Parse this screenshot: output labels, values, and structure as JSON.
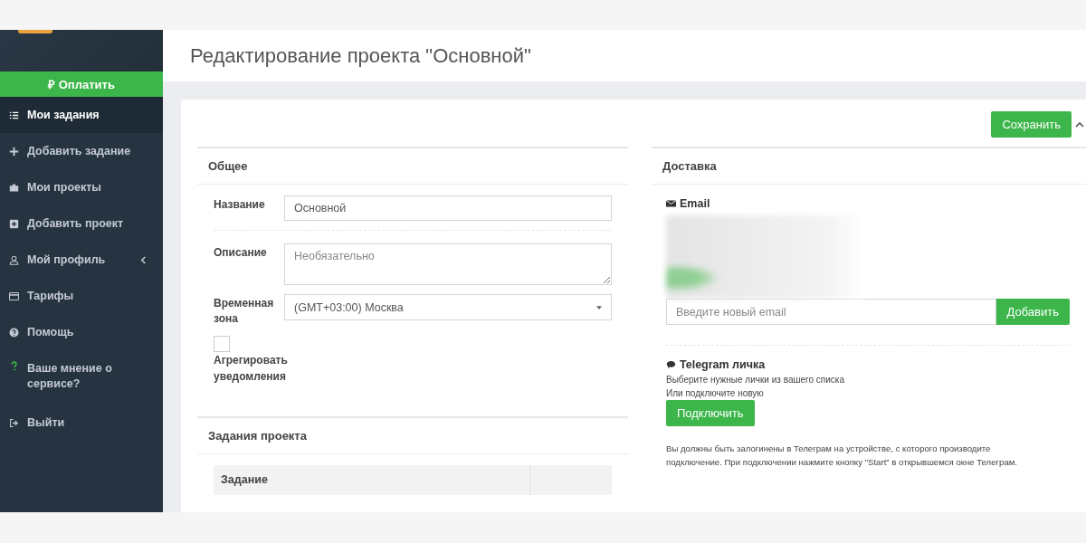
{
  "sidebar": {
    "pay_button": {
      "icon": "₽",
      "label": "Оплатить"
    },
    "items": [
      {
        "kind": "list",
        "label": "Мои задания",
        "selected": true,
        "submenu": false
      },
      {
        "kind": "plus",
        "label": "Добавить задание",
        "selected": false,
        "submenu": false
      },
      {
        "kind": "briefcase",
        "label": "Мои проекты",
        "selected": false,
        "submenu": false
      },
      {
        "kind": "plus-square",
        "label": "Добавить проект",
        "selected": false,
        "submenu": false
      },
      {
        "kind": "user",
        "label": "Мой профиль",
        "selected": false,
        "submenu": true
      },
      {
        "kind": "card",
        "label": "Тарифы",
        "selected": false,
        "submenu": false
      },
      {
        "kind": "help",
        "label": "Помощь",
        "selected": false,
        "submenu": false
      },
      {
        "kind": "question",
        "label": "Ваше мнение о сервисе?",
        "selected": false,
        "submenu": false
      },
      {
        "kind": "exit",
        "label": "Выйти",
        "selected": false,
        "submenu": false
      }
    ]
  },
  "page_title": "Редактирование проекта \"Основной\"",
  "save_button": "Сохранить",
  "general": {
    "title": "Общее",
    "name": {
      "label": "Название",
      "value": "Основной"
    },
    "description": {
      "label": "Описание",
      "placeholder": "Необязательно"
    },
    "timezone": {
      "label": "Временная зона",
      "value": "(GMT+03:00) Москва"
    },
    "aggregate": {
      "label": "Агрегировать уведомления",
      "checked": false
    }
  },
  "tasks": {
    "title": "Задания проекта",
    "columns": [
      "Задание",
      ""
    ]
  },
  "delivery": {
    "title": "Доставка",
    "email": {
      "title": "Email",
      "placeholder": "Введите новый email",
      "button": "Добавить"
    },
    "telegram": {
      "title": "Telegram личка",
      "hint_1": "Выберите нужные лички из вашего списка",
      "hint_2": "Или подключите новую",
      "button": "Подключить",
      "note": "Вы должны быть залогинены в Телеграм на устройстве, с которого производите подключение. При подключении нажмите кнопку \"Start\" в открывшемся окне Телеграм."
    }
  }
}
